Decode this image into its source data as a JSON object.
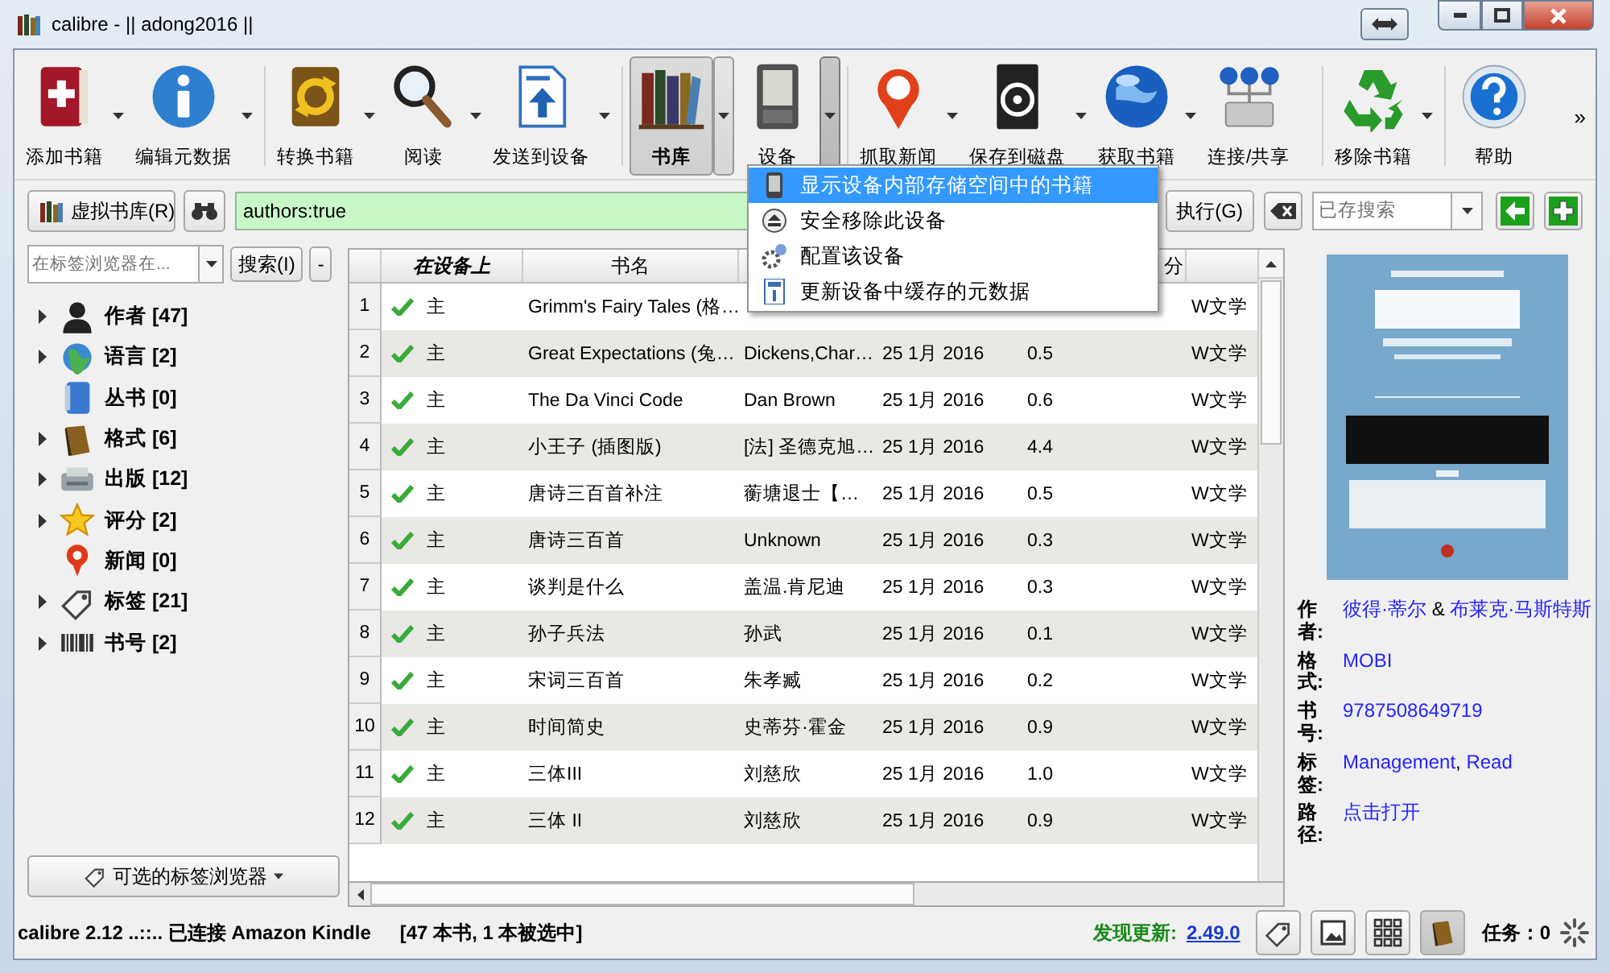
{
  "window": {
    "title": "calibre - || adong2016 ||"
  },
  "toolbar": {
    "items": [
      {
        "kind": "add",
        "label": "添加书籍",
        "dropdown": true,
        "selected": false,
        "menu_open": false
      },
      {
        "kind": "info",
        "label": "编辑元数据",
        "dropdown": true,
        "selected": false,
        "menu_open": false
      },
      {
        "kind": "convert",
        "label": "转换书籍",
        "dropdown": true,
        "selected": false,
        "menu_open": false
      },
      {
        "kind": "read",
        "label": "阅读",
        "dropdown": true,
        "selected": false,
        "menu_open": false
      },
      {
        "kind": "send",
        "label": "发送到设备",
        "dropdown": true,
        "selected": false,
        "menu_open": false
      },
      {
        "kind": "library",
        "label": "书库",
        "dropdown": true,
        "selected": true,
        "menu_open": false
      },
      {
        "kind": "device",
        "label": "设备",
        "dropdown": true,
        "selected": false,
        "menu_open": true
      },
      {
        "kind": "news",
        "label": "抓取新闻",
        "dropdown": true,
        "selected": false,
        "menu_open": false
      },
      {
        "kind": "save",
        "label": "保存到磁盘",
        "dropdown": true,
        "selected": false,
        "menu_open": false
      },
      {
        "kind": "get",
        "label": "获取书籍",
        "dropdown": true,
        "selected": false,
        "menu_open": false
      },
      {
        "kind": "connect",
        "label": "连接/共享",
        "dropdown": false,
        "selected": false
      },
      {
        "kind": "remove",
        "label": "移除书籍",
        "dropdown": true,
        "selected": false,
        "menu_open": false
      },
      {
        "kind": "help",
        "label": "帮助",
        "dropdown": false,
        "selected": false
      }
    ],
    "more": "»"
  },
  "device_menu": {
    "items": [
      {
        "kind": "phone",
        "label": "显示设备内部存储空间中的书籍",
        "selected": true
      },
      {
        "kind": "eject",
        "label": "安全移除此设备",
        "selected": false
      },
      {
        "kind": "gears",
        "label": "配置该设备",
        "selected": false
      },
      {
        "kind": "document",
        "label": "更新设备中缓存的元数据",
        "selected": false
      }
    ]
  },
  "search_bar": {
    "virtual_library": "虚拟书库(R)",
    "query": "authors:true",
    "execute": "执行(G)",
    "saved_search_placeholder": "已存搜索"
  },
  "tag_browser": {
    "filter_placeholder": "在标签浏览器在...",
    "search_button": "搜索(I)",
    "collapse_button": "-",
    "items": [
      {
        "kind": "authors",
        "label": "作者 [47]",
        "expandable": true
      },
      {
        "kind": "languages",
        "label": "语言 [2]",
        "expandable": true
      },
      {
        "kind": "series",
        "label": "丛书 [0]",
        "expandable": false
      },
      {
        "kind": "formats",
        "label": "格式 [6]",
        "expandable": true
      },
      {
        "kind": "publisher",
        "label": "出版 [12]",
        "expandable": true
      },
      {
        "kind": "rating",
        "label": "评分 [2]",
        "expandable": true
      },
      {
        "kind": "news",
        "label": "新闻 [0]",
        "expandable": false
      },
      {
        "kind": "tags",
        "label": "标签 [21]",
        "expandable": true
      },
      {
        "kind": "identifiers",
        "label": "书号 [2]",
        "expandable": true
      }
    ],
    "bottom_button": "可选的标签浏览器"
  },
  "table": {
    "header": {
      "on_device": "在设备上",
      "title": "书名",
      "column_7": "分"
    },
    "rows": [
      {
        "number": "1",
        "on_device": true,
        "location": "主",
        "title": "Grimm's Fairy Tales (格…",
        "tags": "W文学"
      },
      {
        "number": "2",
        "on_device": true,
        "location": "主",
        "title": "Great Expectations (兔…",
        "author": "Dickens,Char…",
        "date": "25 1月 2016",
        "size": "0.5",
        "tags": "W文学"
      },
      {
        "number": "3",
        "on_device": true,
        "location": "主",
        "title": "The Da Vinci Code",
        "author": "Dan Brown",
        "date": "25 1月 2016",
        "size": "0.6",
        "tags": "W文学"
      },
      {
        "number": "4",
        "on_device": true,
        "location": "主",
        "title": "小王子 (插图版)",
        "author": "[法] 圣德克旭…",
        "date": "25 1月 2016",
        "size": "4.4",
        "tags": "W文学"
      },
      {
        "number": "5",
        "on_device": true,
        "location": "主",
        "title": "唐诗三百首补注",
        "author": "蘅塘退士【…",
        "date": "25 1月 2016",
        "size": "0.5",
        "tags": "W文学"
      },
      {
        "number": "6",
        "on_device": true,
        "location": "主",
        "title": "唐诗三百首",
        "author": "Unknown",
        "date": "25 1月 2016",
        "size": "0.3",
        "tags": "W文学"
      },
      {
        "number": "7",
        "on_device": true,
        "location": "主",
        "title": "谈判是什么",
        "author": "盖温.肯尼迪",
        "date": "25 1月 2016",
        "size": "0.3",
        "tags": "W文学"
      },
      {
        "number": "8",
        "on_device": true,
        "location": "主",
        "title": "孙子兵法",
        "author": "孙武",
        "date": "25 1月 2016",
        "size": "0.1",
        "tags": "W文学"
      },
      {
        "number": "9",
        "on_device": true,
        "location": "主",
        "title": "宋词三百首",
        "author": "朱孝臧",
        "date": "25 1月 2016",
        "size": "0.2",
        "tags": "W文学"
      },
      {
        "number": "10",
        "on_device": true,
        "location": "主",
        "title": "时间简史",
        "author": "史蒂芬·霍金",
        "date": "25 1月 2016",
        "size": "0.9",
        "tags": "W文学"
      },
      {
        "number": "11",
        "on_device": true,
        "location": "主",
        "title": "三体III",
        "author": "刘慈欣",
        "date": "25 1月 2016",
        "size": "1.0",
        "tags": "W文学"
      },
      {
        "number": "12",
        "on_device": true,
        "location": "主",
        "title": "三体 II",
        "author": "刘慈欣",
        "date": "25 1月 2016",
        "size": "0.9",
        "tags": "W文学"
      }
    ]
  },
  "book_details": {
    "fields": [
      {
        "label": "作者:",
        "parts": [
          {
            "text": "彼得·蒂尔",
            "link": true
          },
          {
            "text": " & ",
            "link": false
          },
          {
            "text": "布莱克·马斯特斯",
            "link": true
          }
        ]
      },
      {
        "label": "格式:",
        "parts": [
          {
            "text": "MOBI",
            "link": true
          }
        ]
      },
      {
        "label": "书号:",
        "parts": [
          {
            "text": "9787508649719",
            "link": true
          }
        ]
      },
      {
        "label": "标签:",
        "parts": [
          {
            "text": "Management",
            "link": true
          },
          {
            "text": ", ",
            "link": false
          },
          {
            "text": "Read",
            "link": true
          }
        ]
      },
      {
        "label": "路径:",
        "parts": [
          {
            "text": "点击打开",
            "link": true
          }
        ]
      }
    ]
  },
  "status_bar": {
    "text": "calibre 2.12 ..::.. 已连接 Amazon Kindle",
    "count": "[47 本书, 1 本被选中]",
    "update_label": "发现更新:",
    "update_version": "2.49.0",
    "jobs": "任务：0"
  }
}
